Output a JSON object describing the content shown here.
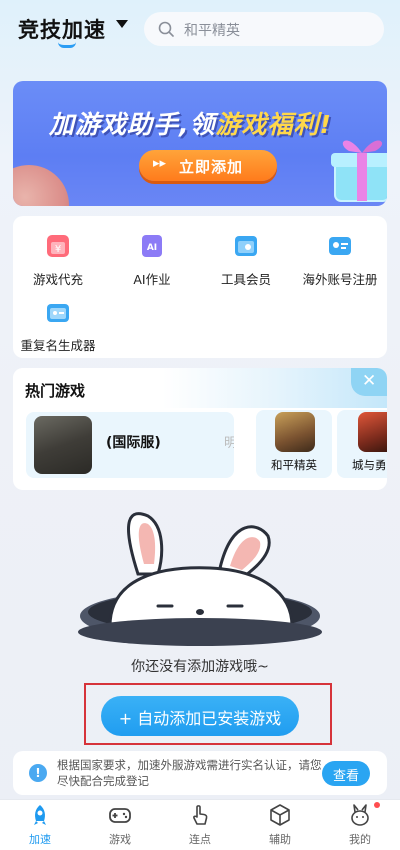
{
  "header": {
    "title": "竞技加速",
    "search_placeholder": "和平精英"
  },
  "banner": {
    "headline_part1": "加游戏助手,领",
    "headline_part2": "游戏福利!",
    "cta_label": "立即添加",
    "cta_arrows": "▸▸"
  },
  "tools": [
    {
      "label": "游戏代充",
      "icon": "yen-card-icon"
    },
    {
      "label": "AI作业",
      "icon": "ai-doc-icon"
    },
    {
      "label": "工具会员",
      "icon": "wrench-member-icon"
    },
    {
      "label": "海外账号注册",
      "icon": "id-card-icon"
    },
    {
      "label": "重复名生成器",
      "icon": "rabbit-card-icon"
    }
  ],
  "hot_games": {
    "title": "热门游戏",
    "close_glyph": "✕",
    "featured_label": "(国际服)",
    "featured_cut": "明",
    "items": [
      {
        "label": "和平精英"
      },
      {
        "label": "城与勇士"
      }
    ]
  },
  "empty_state": {
    "message": "你还没有添加游戏哦~",
    "button_label": "+ 自动添加已安装游戏"
  },
  "notice": {
    "text": "根据国家要求，加速外服游戏需进行实名认证，请您尽快配合完成登记",
    "button_label": "查看"
  },
  "nav": [
    {
      "label": "加速",
      "active": true
    },
    {
      "label": "游戏"
    },
    {
      "label": "连点"
    },
    {
      "label": "辅助"
    },
    {
      "label": "我的"
    }
  ],
  "colors": {
    "accent": "#1e9af0",
    "banner_bg": "#5d7ef3",
    "cta": "#ff7b1c",
    "highlight_box": "#d6333a"
  }
}
